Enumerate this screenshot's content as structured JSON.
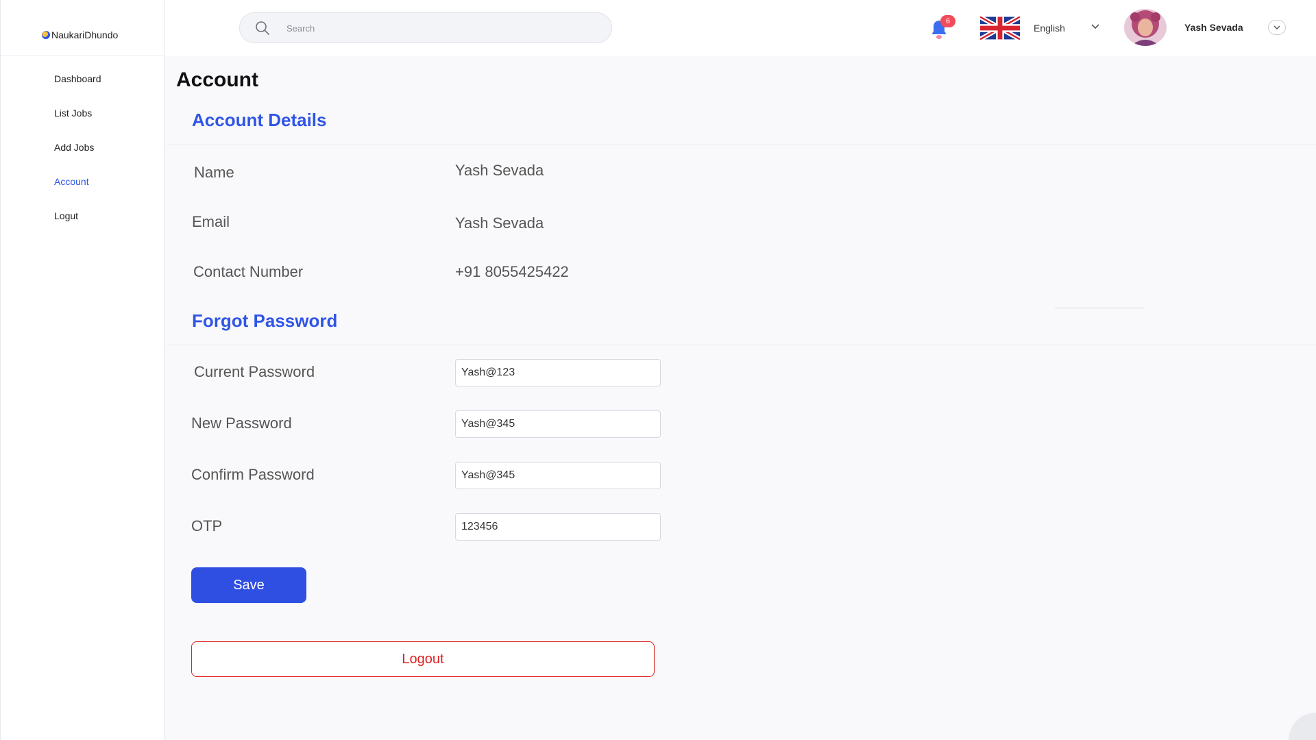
{
  "brand": {
    "name": "NaukariDhundo"
  },
  "sidebar": {
    "items": [
      {
        "label": "Dashboard",
        "active": false
      },
      {
        "label": "List Jobs",
        "active": false
      },
      {
        "label": "Add Jobs",
        "active": false
      },
      {
        "label": "Account",
        "active": true
      },
      {
        "label": "Logut",
        "active": false
      }
    ]
  },
  "topbar": {
    "search_placeholder": "Search",
    "notifications_count": "6",
    "language": "English",
    "user_name": "Yash Sevada"
  },
  "page": {
    "title": "Account"
  },
  "account_details": {
    "title": "Account Details",
    "name_label": "Name",
    "name_value": "Yash Sevada",
    "email_label": "Email",
    "email_value": "Yash Sevada",
    "contact_label": "Contact Number",
    "contact_value": "+91 8055425422"
  },
  "forgot_password": {
    "title": "Forgot Password",
    "current_label": "Current Password",
    "current_value": "Yash@123",
    "new_label": "New Password",
    "new_value": "Yash@345",
    "confirm_label": "Confirm Password",
    "confirm_value": "Yash@345",
    "otp_label": "OTP",
    "otp_value": "123456"
  },
  "actions": {
    "save_label": "Save",
    "logout_label": "Logout"
  },
  "colors": {
    "accent": "#2f55e6",
    "danger": "#e02020",
    "badge": "#f24b5a"
  }
}
